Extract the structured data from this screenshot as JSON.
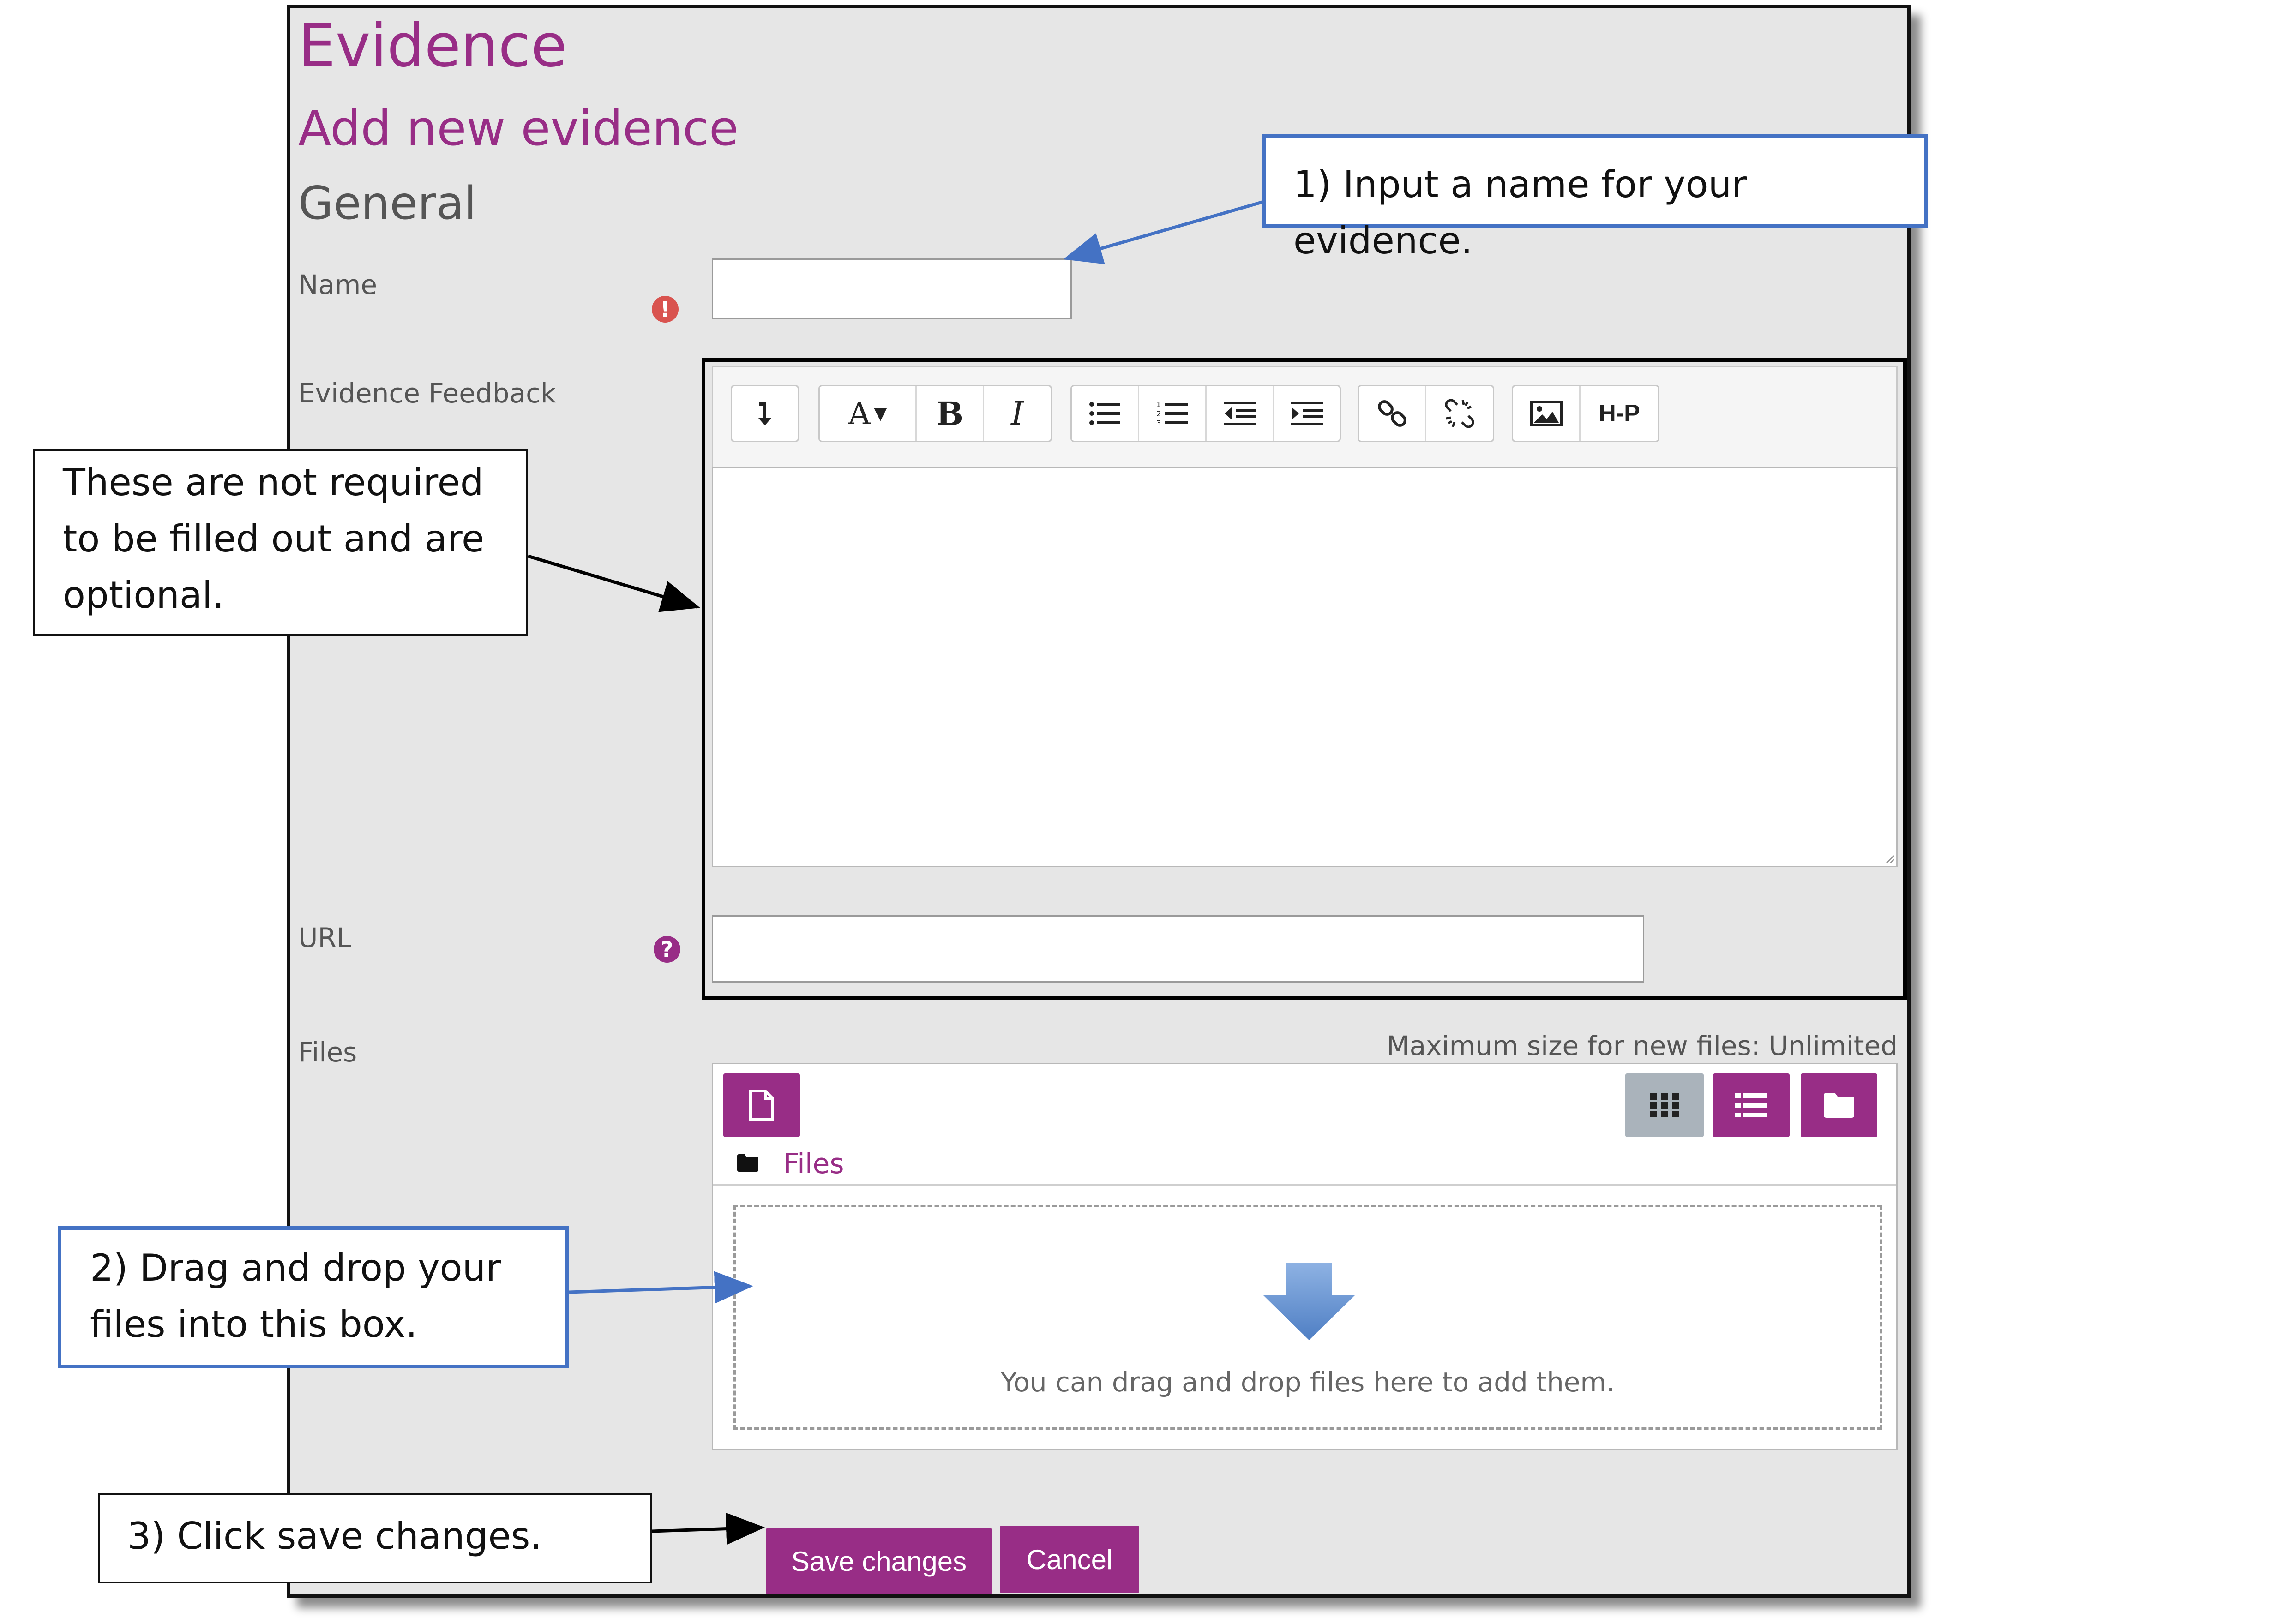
{
  "page": {
    "title": "Evidence",
    "subtitle": "Add new evidence",
    "section": "General"
  },
  "form": {
    "name_label": "Name",
    "name_value": "",
    "name_required_icon": "exclamation-circle-icon",
    "feedback_label": "Evidence Feedback",
    "url_label": "URL",
    "url_value": "",
    "url_help_icon": "question-circle-icon",
    "files_label": "Files",
    "max_size_text": "Maximum size for new files: Unlimited",
    "files_path_label": "Files",
    "drop_text": "You can drag and drop files here to add them."
  },
  "editor": {
    "toolbar_icons": [
      "collapse-icon",
      "font-style-icon",
      "bold-icon",
      "italic-icon",
      "unordered-list-icon",
      "ordered-list-icon",
      "outdent-icon",
      "indent-icon",
      "link-icon",
      "unlink-icon",
      "image-icon",
      "h5p-icon"
    ],
    "font_label": "A",
    "bold_label": "B",
    "italic_label": "I",
    "h5p_label": "H-P"
  },
  "buttons": {
    "save": "Save changes",
    "cancel": "Cancel"
  },
  "callouts": {
    "step1": "1) Input a name for your evidence.",
    "optional_line1": "These are not required",
    "optional_line2": "to be filled out and are",
    "optional_line3": "optional.",
    "step2_line1": "2) Drag and drop your",
    "step2_line2": "files into this box.",
    "step3": "3) Click save changes."
  },
  "colors": {
    "accent": "#982d86",
    "callout_blue": "#4472c4",
    "required_red": "#d9534f"
  }
}
